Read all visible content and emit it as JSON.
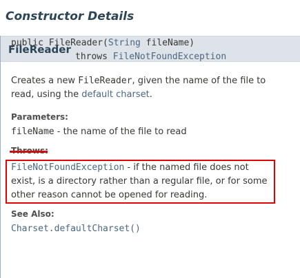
{
  "section": {
    "heading": "Constructor Details"
  },
  "constructor": {
    "name": "FileReader",
    "signature": {
      "prefix": "public FileReader(",
      "param_type": "String",
      "param_name": " fileName)",
      "throws_kw": "throws ",
      "throws_type": "FileNotFoundException"
    },
    "description": {
      "pre": "Creates a new ",
      "code": "FileReader",
      "mid": ", given the name of the file to read, using the ",
      "link": "default charset",
      "post": "."
    },
    "parameters": {
      "label": "Parameters:",
      "name": "fileName",
      "desc": " - the name of the file to read"
    },
    "throws": {
      "label": "Throws:",
      "type": "FileNotFoundException",
      "desc": " - if the named file does not exist, is a directory rather than a regular file, or for some other reason cannot be opened for reading."
    },
    "see_also": {
      "label": "See Also:",
      "link": "Charset.defaultCharset()"
    }
  },
  "colors": {
    "header_bg": "#dee3e9",
    "link": "#4a6782",
    "highlight_box": "#e00000"
  }
}
